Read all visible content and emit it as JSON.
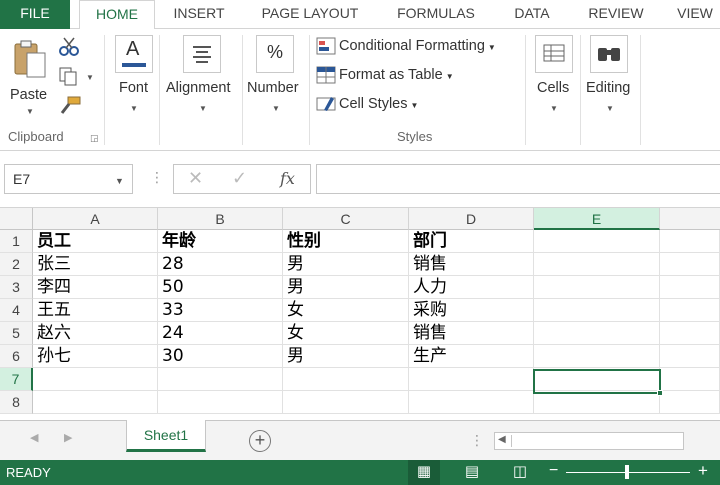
{
  "ribbon_tabs": [
    "FILE",
    "HOME",
    "INSERT",
    "PAGE LAYOUT",
    "FORMULAS",
    "DATA",
    "REVIEW",
    "VIEW"
  ],
  "clipboard": {
    "paste": "Paste",
    "group": "Clipboard"
  },
  "font": {
    "label": "Font"
  },
  "alignment": {
    "label": "Alignment"
  },
  "number": {
    "label": "Number"
  },
  "styles": {
    "conditional": "Conditional Formatting",
    "format_table": "Format as Table",
    "cell_styles": "Cell Styles",
    "group": "Styles"
  },
  "cells": {
    "label": "Cells"
  },
  "editing": {
    "label": "Editing"
  },
  "formula_bar": {
    "name_box": "E7",
    "formula": ""
  },
  "grid": {
    "columns": [
      "A",
      "B",
      "C",
      "D",
      "E"
    ],
    "rows": [
      "1",
      "2",
      "3",
      "4",
      "5",
      "6",
      "7",
      "8"
    ],
    "data": [
      [
        "员工",
        "年龄",
        "性别",
        "部门",
        ""
      ],
      [
        "张三",
        "28",
        "男",
        "销售",
        ""
      ],
      [
        "李四",
        "50",
        "男",
        "人力",
        ""
      ],
      [
        "王五",
        "33",
        "女",
        "采购",
        ""
      ],
      [
        "赵六",
        "24",
        "女",
        "销售",
        ""
      ],
      [
        "孙七",
        "30",
        "男",
        "生产",
        ""
      ],
      [
        "",
        "",
        "",
        "",
        ""
      ],
      [
        "",
        "",
        "",
        "",
        ""
      ]
    ]
  },
  "sheet_tab": "Sheet1",
  "status": {
    "text": "READY"
  },
  "colors": {
    "accent": "#217346"
  }
}
